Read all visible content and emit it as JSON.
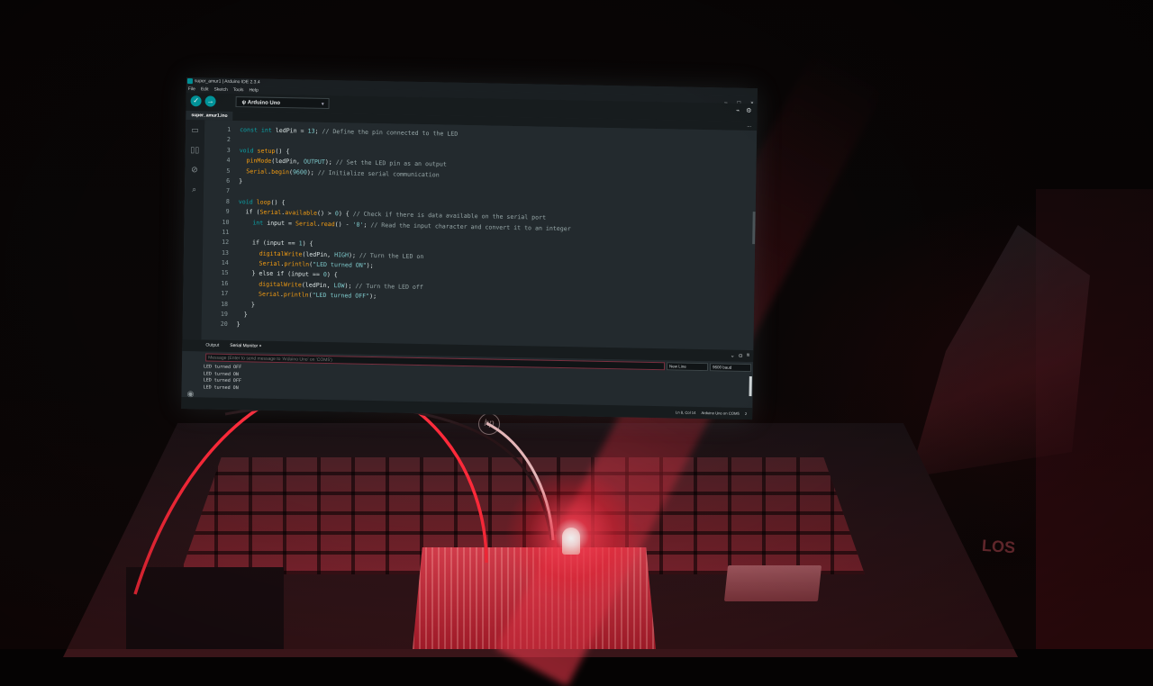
{
  "window": {
    "title": "super_amur1 | Arduino IDE 2.3.4"
  },
  "menu": [
    "File",
    "Edit",
    "Sketch",
    "Tools",
    "Help"
  ],
  "window_controls": {
    "minimize": "–",
    "maximize": "□",
    "close": "×"
  },
  "toolbar": {
    "verify_icon": "✓",
    "upload_icon": "→",
    "board_icon": "ψ",
    "board": "Arduino Uno",
    "board_caret": "▾",
    "right_icons": [
      "⌁",
      "⚙"
    ]
  },
  "tab": {
    "file": "super_amur1.ino",
    "more": "..."
  },
  "side_icons": [
    "▭",
    "▯▯",
    "⊘",
    "⌕"
  ],
  "code_lines": [
    {
      "n": "1",
      "tokens": [
        {
          "t": "const ",
          "c": "tok-kw"
        },
        {
          "t": "int ",
          "c": "tok-kw"
        },
        {
          "t": "ledPin = ",
          "c": "tok-var"
        },
        {
          "t": "13",
          "c": "tok-num"
        },
        {
          "t": "; ",
          "c": "tok-var"
        },
        {
          "t": "// Define the pin connected to the LED",
          "c": "tok-cmt"
        }
      ]
    },
    {
      "n": "2",
      "tokens": []
    },
    {
      "n": "3",
      "tokens": [
        {
          "t": "void ",
          "c": "tok-kw"
        },
        {
          "t": "setup",
          "c": "tok-fn"
        },
        {
          "t": "() {",
          "c": "tok-var"
        }
      ]
    },
    {
      "n": "4",
      "tokens": [
        {
          "t": "  ",
          "c": "tok-var"
        },
        {
          "t": "pinMode",
          "c": "tok-fn"
        },
        {
          "t": "(ledPin, ",
          "c": "tok-var"
        },
        {
          "t": "OUTPUT",
          "c": "tok-num"
        },
        {
          "t": "); ",
          "c": "tok-var"
        },
        {
          "t": "// Set the LED pin as an output",
          "c": "tok-cmt"
        }
      ]
    },
    {
      "n": "5",
      "tokens": [
        {
          "t": "  ",
          "c": "tok-var"
        },
        {
          "t": "Serial",
          "c": "tok-obj"
        },
        {
          "t": ".",
          "c": "tok-var"
        },
        {
          "t": "begin",
          "c": "tok-fn"
        },
        {
          "t": "(",
          "c": "tok-var"
        },
        {
          "t": "9600",
          "c": "tok-num"
        },
        {
          "t": "); ",
          "c": "tok-var"
        },
        {
          "t": "// Initialize serial communication",
          "c": "tok-cmt"
        }
      ]
    },
    {
      "n": "6",
      "tokens": [
        {
          "t": "}",
          "c": "tok-var"
        }
      ]
    },
    {
      "n": "7",
      "tokens": []
    },
    {
      "n": "8",
      "tokens": [
        {
          "t": "void ",
          "c": "tok-kw"
        },
        {
          "t": "loop",
          "c": "tok-fn"
        },
        {
          "t": "() {",
          "c": "tok-var"
        }
      ]
    },
    {
      "n": "9",
      "tokens": [
        {
          "t": "  if (",
          "c": "tok-var"
        },
        {
          "t": "Serial",
          "c": "tok-obj"
        },
        {
          "t": ".",
          "c": "tok-var"
        },
        {
          "t": "available",
          "c": "tok-fn"
        },
        {
          "t": "() > ",
          "c": "tok-var"
        },
        {
          "t": "0",
          "c": "tok-num"
        },
        {
          "t": ") { ",
          "c": "tok-var"
        },
        {
          "t": "// Check if there is data available on the serial port",
          "c": "tok-cmt"
        }
      ]
    },
    {
      "n": "10",
      "tokens": [
        {
          "t": "    ",
          "c": "tok-var"
        },
        {
          "t": "int ",
          "c": "tok-kw"
        },
        {
          "t": "input = ",
          "c": "tok-var"
        },
        {
          "t": "Serial",
          "c": "tok-obj"
        },
        {
          "t": ".",
          "c": "tok-var"
        },
        {
          "t": "read",
          "c": "tok-fn"
        },
        {
          "t": "() - ",
          "c": "tok-var"
        },
        {
          "t": "'0'",
          "c": "tok-str"
        },
        {
          "t": "; ",
          "c": "tok-var"
        },
        {
          "t": "// Read the input character and convert it to an integer",
          "c": "tok-cmt"
        }
      ]
    },
    {
      "n": "11",
      "tokens": []
    },
    {
      "n": "12",
      "tokens": [
        {
          "t": "    if (input == ",
          "c": "tok-var"
        },
        {
          "t": "1",
          "c": "tok-num"
        },
        {
          "t": ") {",
          "c": "tok-var"
        }
      ]
    },
    {
      "n": "13",
      "tokens": [
        {
          "t": "      ",
          "c": "tok-var"
        },
        {
          "t": "digitalWrite",
          "c": "tok-fn"
        },
        {
          "t": "(ledPin, ",
          "c": "tok-var"
        },
        {
          "t": "HIGH",
          "c": "tok-num"
        },
        {
          "t": "); ",
          "c": "tok-var"
        },
        {
          "t": "// Turn the LED on",
          "c": "tok-cmt"
        }
      ]
    },
    {
      "n": "14",
      "tokens": [
        {
          "t": "      ",
          "c": "tok-var"
        },
        {
          "t": "Serial",
          "c": "tok-obj"
        },
        {
          "t": ".",
          "c": "tok-var"
        },
        {
          "t": "println",
          "c": "tok-fn"
        },
        {
          "t": "(",
          "c": "tok-var"
        },
        {
          "t": "\"LED turned ON\"",
          "c": "tok-str"
        },
        {
          "t": ");",
          "c": "tok-var"
        }
      ]
    },
    {
      "n": "15",
      "tokens": [
        {
          "t": "    } else if (input == ",
          "c": "tok-var"
        },
        {
          "t": "0",
          "c": "tok-num"
        },
        {
          "t": ") {",
          "c": "tok-var"
        }
      ]
    },
    {
      "n": "16",
      "tokens": [
        {
          "t": "      ",
          "c": "tok-var"
        },
        {
          "t": "digitalWrite",
          "c": "tok-fn"
        },
        {
          "t": "(ledPin, ",
          "c": "tok-var"
        },
        {
          "t": "LOW",
          "c": "tok-num"
        },
        {
          "t": "); ",
          "c": "tok-var"
        },
        {
          "t": "// Turn the LED off",
          "c": "tok-cmt"
        }
      ]
    },
    {
      "n": "17",
      "tokens": [
        {
          "t": "      ",
          "c": "tok-var"
        },
        {
          "t": "Serial",
          "c": "tok-obj"
        },
        {
          "t": ".",
          "c": "tok-var"
        },
        {
          "t": "println",
          "c": "tok-fn"
        },
        {
          "t": "(",
          "c": "tok-var"
        },
        {
          "t": "\"LED turned OFF\"",
          "c": "tok-str"
        },
        {
          "t": ");",
          "c": "tok-var"
        }
      ]
    },
    {
      "n": "18",
      "tokens": [
        {
          "t": "    }",
          "c": "tok-var"
        }
      ]
    },
    {
      "n": "19",
      "tokens": [
        {
          "t": "  }",
          "c": "tok-var"
        }
      ]
    },
    {
      "n": "20",
      "tokens": [
        {
          "t": "}",
          "c": "tok-var"
        }
      ]
    }
  ],
  "panel": {
    "tabs": [
      "Output",
      "Serial Monitor"
    ],
    "close": "×",
    "icons": [
      "⌄",
      "⊙",
      "≡"
    ],
    "message_placeholder": "Message (Enter to send message to 'Arduino Uno' on 'COM5')",
    "line_ending": "New Line",
    "baud": "9600 baud",
    "output_lines": [
      "LED turned OFF",
      "LED turned ON",
      "LED turned OFF",
      "LED turned ON"
    ]
  },
  "statusbar": {
    "position": "Ln 8, Col 14",
    "board_port": "Arduino Uno on COM5",
    "notifications": "2"
  },
  "laptop": {
    "brand_mark": "hp"
  },
  "background_label": "LOS"
}
